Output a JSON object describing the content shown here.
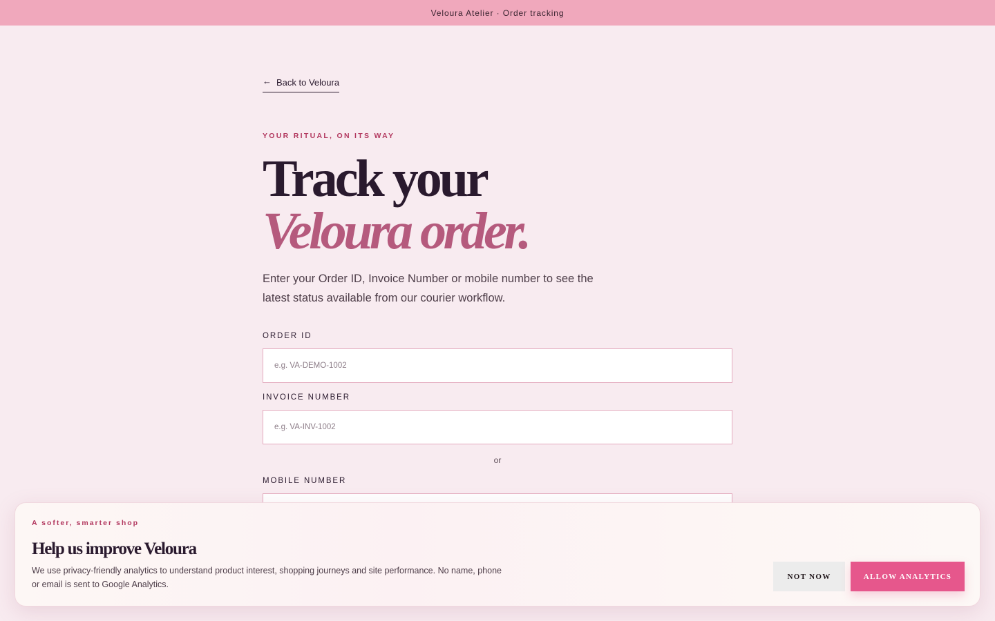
{
  "topbar": {
    "title": "Veloura Atelier · Order tracking"
  },
  "nav": {
    "back_arrow": "←",
    "back_label": "Back to Veloura",
    "back_icon": "arrow-left-icon"
  },
  "hero": {
    "eyebrow": "YOUR RITUAL, ON ITS WAY",
    "title_line1": "Track your",
    "title_line2": "Veloura order.",
    "intro": "Enter your Order ID, Invoice Number or mobile number to see the latest status available from our courier workflow."
  },
  "form": {
    "order_id": {
      "label": "ORDER ID",
      "placeholder": "e.g. VA-DEMO-1002",
      "value": ""
    },
    "invoice": {
      "label": "INVOICE NUMBER",
      "placeholder": "e.g. VA-INV-1002",
      "value": ""
    },
    "separator": "or",
    "mobile": {
      "label": "MOBILE NUMBER",
      "placeholder": "",
      "value": ""
    }
  },
  "consent": {
    "kicker": "A softer, smarter shop",
    "title": "Help us improve Veloura",
    "body": "We use privacy-friendly analytics to understand product interest, shopping journeys and site performance. No name, phone or email is sent to Google Analytics.",
    "decline_label": "NOT NOW",
    "accept_label": "ALLOW ANALYTICS"
  },
  "colors": {
    "topbar_bg": "#f0a8bc",
    "page_bg": "#f8ebf0",
    "accent": "#b2385f",
    "title_italic": "#b55a7d",
    "primary_button": "#e6578c"
  }
}
